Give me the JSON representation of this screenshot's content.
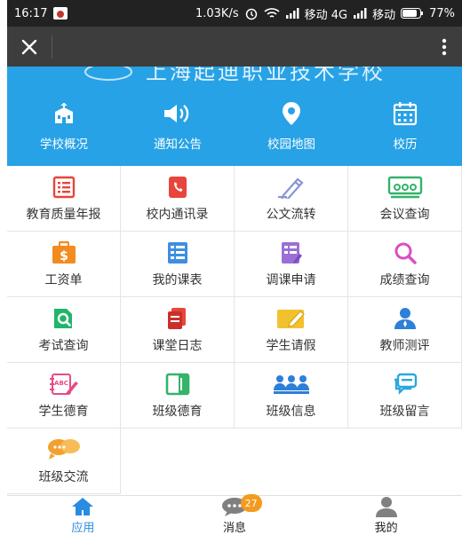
{
  "status_bar": {
    "time": "16:17",
    "speed": "1.03K/s",
    "carrier1": "移动 4G",
    "carrier2": "移动",
    "battery": "77%"
  },
  "header": {
    "school_name": "上海起迪职业技术学校"
  },
  "quick_links": [
    {
      "label": "学校概况",
      "icon": "school-building-icon"
    },
    {
      "label": "通知公告",
      "icon": "speaker-icon"
    },
    {
      "label": "校园地图",
      "icon": "map-pin-icon"
    },
    {
      "label": "校历",
      "icon": "calendar-icon"
    }
  ],
  "grid": [
    {
      "label": "教育质量年报",
      "icon": "report-icon",
      "color": "#e8453c"
    },
    {
      "label": "校内通讯录",
      "icon": "contacts-book-icon",
      "color": "#e8453c"
    },
    {
      "label": "公文流转",
      "icon": "pen-icon",
      "color": "#8a94d8"
    },
    {
      "label": "会议查询",
      "icon": "meeting-icon",
      "color": "#33b36b"
    },
    {
      "label": "工资单",
      "icon": "salary-icon",
      "color": "#f28b20"
    },
    {
      "label": "我的课表",
      "icon": "schedule-icon",
      "color": "#3d8fe0"
    },
    {
      "label": "调课申请",
      "icon": "reschedule-icon",
      "color": "#9c6fd6"
    },
    {
      "label": "成绩查询",
      "icon": "search-icon",
      "color": "#d94fc4"
    },
    {
      "label": "考试查询",
      "icon": "exam-search-icon",
      "color": "#20b56a"
    },
    {
      "label": "课堂日志",
      "icon": "class-log-icon",
      "color": "#e8453c"
    },
    {
      "label": "学生请假",
      "icon": "leave-request-icon",
      "color": "#f2c12e"
    },
    {
      "label": "教师测评",
      "icon": "teacher-icon",
      "color": "#2d7fd8"
    },
    {
      "label": "学生德育",
      "icon": "abc-notebook-icon",
      "color": "#e84a86"
    },
    {
      "label": "班级德育",
      "icon": "book-icon",
      "color": "#33b36b"
    },
    {
      "label": "班级信息",
      "icon": "group-icon",
      "color": "#2d7fd8"
    },
    {
      "label": "班级留言",
      "icon": "message-icon",
      "color": "#2aa7de"
    },
    {
      "label": "班级交流",
      "icon": "chat-bubbles-icon",
      "color": "#f2a12e"
    }
  ],
  "bottom_nav": [
    {
      "label": "应用",
      "icon": "home-icon",
      "active": true
    },
    {
      "label": "消息",
      "icon": "chat-icon",
      "badge": "27"
    },
    {
      "label": "我的",
      "icon": "person-icon"
    }
  ],
  "colors": {
    "header_blue": "#27a2e6",
    "active_tab": "#2a8be0",
    "inactive_tab": "#222222"
  }
}
